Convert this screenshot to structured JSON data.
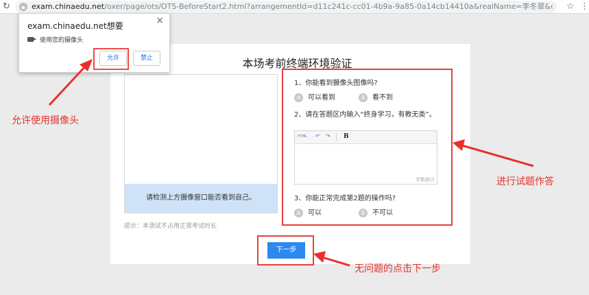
{
  "browser": {
    "url_host": "exam.chinaedu.net",
    "url_rest": "/oxer/page/ots/OTS-BeforeStart2.html?arrangementId=d11c241c-cc01-4b9a-9a85-0a14cb14410a&realName=李冬翠&codes=00252&resourceP..."
  },
  "permission_popup": {
    "title": "exam.chinaedu.net想要",
    "permission": "使用您的摄像头",
    "allow_label": "允许",
    "block_label": "禁止",
    "close": "×"
  },
  "card": {
    "title": "本场考前终端环境验证",
    "video_caption": "请检测上方摄像窗口能否看到自己。",
    "hint": "提示：本测试不占用正常考试时长",
    "next_label": "下一步"
  },
  "questions": {
    "q1": "1、你能看到摄像头图像吗?",
    "q1_options": [
      {
        "letter": "A",
        "text": "可以看到"
      },
      {
        "letter": "B",
        "text": "看不到"
      }
    ],
    "q2": "2、请在答题区内输入“终身学习，有教无类”。",
    "editor": {
      "html_label": "HTML",
      "undo": "↶",
      "redo": "↷",
      "bold": "B",
      "count_label": "字数统计"
    },
    "q3": "3、你能正常完成第2题的操作吗?",
    "q3_options": [
      {
        "letter": "A",
        "text": "可以"
      },
      {
        "letter": "B",
        "text": "不可以"
      }
    ]
  },
  "annotations": {
    "allow_camera": "允许使用摄像头",
    "answer_questions": "进行试题作答",
    "click_next": "无问题的点击下一步"
  },
  "colors": {
    "annotation_red": "#e8302a",
    "primary_blue": "#2d89ef",
    "caption_bg": "#cfe2f7"
  }
}
